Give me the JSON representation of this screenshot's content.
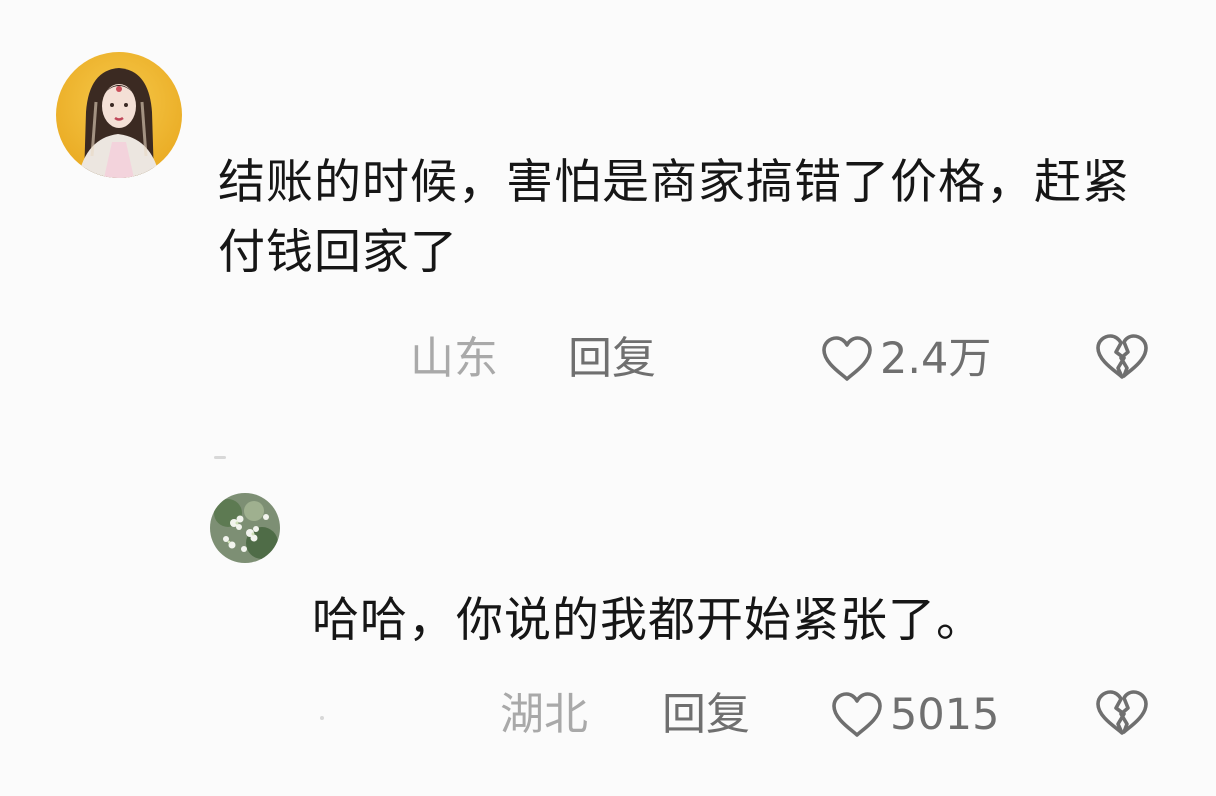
{
  "comments": [
    {
      "text": "结账的时候，害怕是商家搞错了价格，赶紧付钱回家了",
      "location": "山东",
      "reply_label": "回复",
      "likes": "2.4万",
      "avatar_icon": "avatar-costume-girl",
      "like_icon": "heart-outline",
      "dislike_icon": "broken-heart-outline"
    },
    {
      "text": "哈哈，你说的我都开始紧张了。",
      "location": "湖北",
      "reply_label": "回复",
      "likes": "5015",
      "avatar_icon": "avatar-green-flowers",
      "like_icon": "heart-outline",
      "dislike_icon": "broken-heart-outline"
    }
  ]
}
